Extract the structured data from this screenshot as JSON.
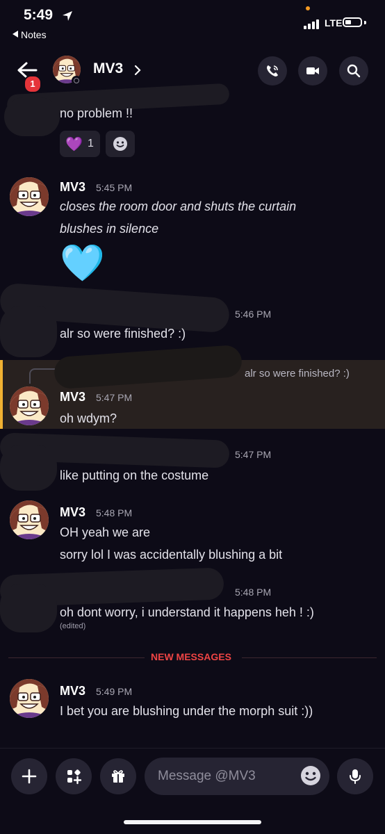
{
  "status_bar": {
    "time": "5:49",
    "back_app": "Notes",
    "network": "LTE"
  },
  "header": {
    "name": "MV3",
    "unread_badge": "1"
  },
  "messages": [
    {
      "text": "no problem !!",
      "reactions": [
        {
          "emoji": "💜",
          "count": "1"
        }
      ]
    },
    {
      "author": "MV3",
      "time": "5:45 PM",
      "lines": [
        "closes the room door and shuts the curtain",
        "blushes in silence"
      ],
      "emoji": "🩵"
    },
    {
      "time": "5:46 PM",
      "text": "alr so were finished? :)"
    },
    {
      "reply_to": "alr so were finished? :)",
      "author": "MV3",
      "time": "5:47 PM",
      "text": "oh wdym?"
    },
    {
      "time": "5:47 PM",
      "text": "like putting on the costume"
    },
    {
      "author": "MV3",
      "time": "5:48 PM",
      "lines": [
        "OH yeah we are",
        "sorry lol I was accidentally blushing a bit"
      ]
    },
    {
      "time": "5:48 PM",
      "text": "oh dont worry, i understand it happens heh ! :)",
      "edited": "(edited)"
    },
    {
      "author": "MV3",
      "time": "5:49 PM",
      "text": "I bet you are blushing under the morph suit :))"
    }
  ],
  "divider_label": "NEW MESSAGES",
  "composer": {
    "placeholder": "Message @MV3"
  },
  "colors": {
    "background": "#0d0b17",
    "accent_new": "#ef4444",
    "reply_highlight": "#f0b132",
    "badge": "#e5343a"
  }
}
